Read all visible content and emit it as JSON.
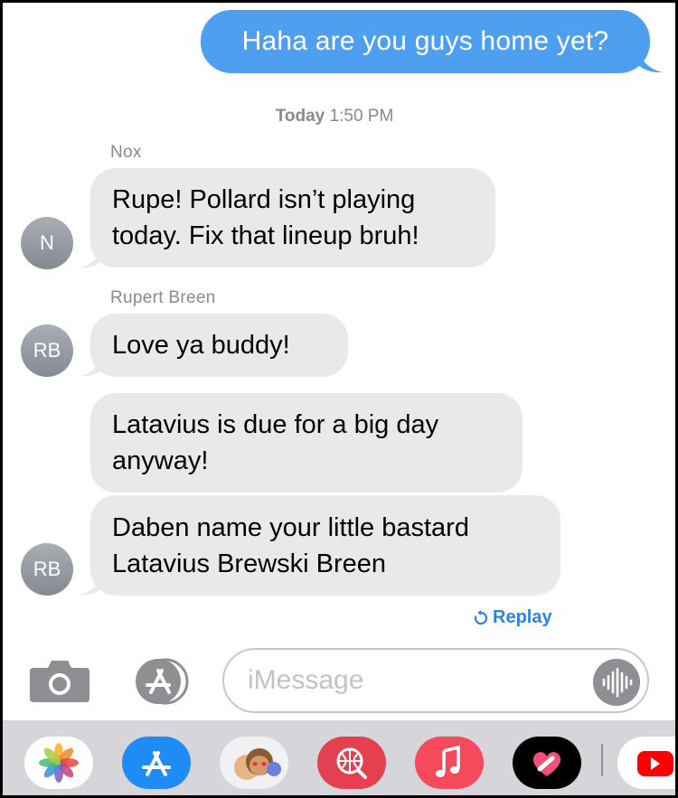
{
  "conversation": {
    "outgoing": [
      {
        "text": "Haha are you guys home yet?"
      }
    ],
    "timestamp": {
      "day": "Today",
      "time": "1:50 PM"
    },
    "groups": [
      {
        "sender": "Nox",
        "avatar_initials": "N",
        "messages": [
          "Rupe! Pollard isn’t playing\ntoday. Fix that lineup bruh!"
        ]
      },
      {
        "sender": "Rupert Breen",
        "avatar_initials": "RB",
        "messages": [
          "Love ya buddy!",
          "Latavius is due for a big day\nanyway!",
          "Daben name your little bastard\nLatavius Brewski Breen"
        ]
      }
    ],
    "replay_label": "Replay"
  },
  "compose": {
    "placeholder": "iMessage",
    "camera_icon": "camera-icon",
    "apps_icon": "app-store-icon",
    "mic_icon": "audio-waveform-icon"
  },
  "app_drawer": {
    "apps": [
      {
        "name": "photos-app-icon"
      },
      {
        "name": "app-store-app-icon"
      },
      {
        "name": "memoji-app-icon"
      },
      {
        "name": "search-images-app-icon"
      },
      {
        "name": "music-app-icon"
      },
      {
        "name": "digital-touch-app-icon"
      },
      {
        "name": "youtube-app-icon"
      }
    ]
  },
  "colors": {
    "outgoing_bubble": "#4f9ff0",
    "incoming_bubble": "#e9e9eb",
    "link": "#2f80ef",
    "avatar": "#9a9ea5",
    "drawer": "#d6d6da"
  }
}
